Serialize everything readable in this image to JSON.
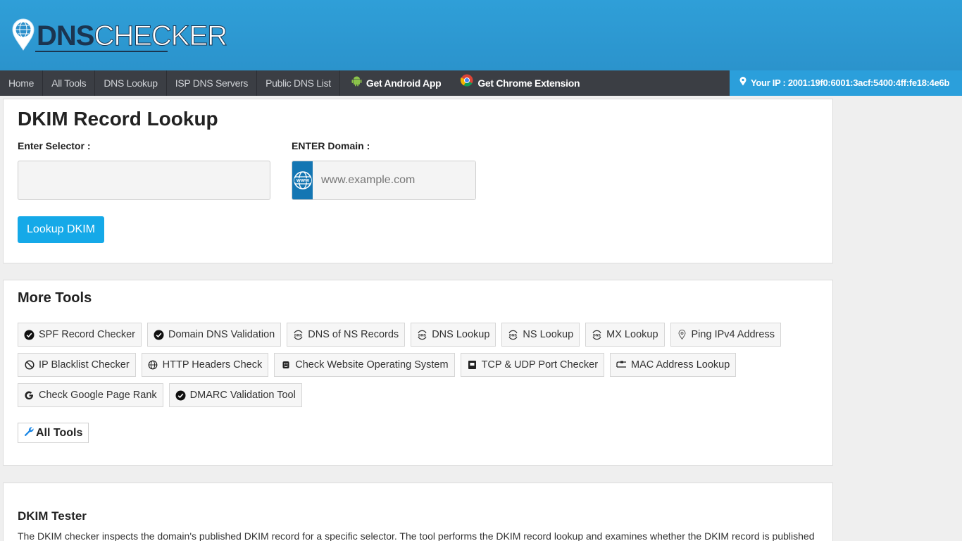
{
  "brand": {
    "logo_text_dns": "DNS",
    "logo_text_checker": "CHECKER",
    "header_color": "#2f9fd8"
  },
  "nav": {
    "items": [
      {
        "label": "Home"
      },
      {
        "label": "All Tools"
      },
      {
        "label": "DNS Lookup"
      },
      {
        "label": "ISP DNS Servers"
      },
      {
        "label": "Public DNS List"
      }
    ],
    "android_label": "Get Android App",
    "chrome_label": "Get Chrome Extension",
    "ip_text": "Your IP : 2001:19f0:6001:3acf:5400:4ff:fe18:4e6b"
  },
  "lookup": {
    "title": "DKIM Record Lookup",
    "selector_label": "Enter Selector :",
    "selector_value": "",
    "domain_label": "ENTER Domain :",
    "domain_placeholder": "www.example.com",
    "button_label": "Lookup DKIM",
    "accent": "#15a9e8"
  },
  "more_tools": {
    "title": "More Tools",
    "items": [
      {
        "label": "SPF Record Checker",
        "icon": "check-circle-icon"
      },
      {
        "label": "Domain DNS Validation",
        "icon": "check-circle-icon"
      },
      {
        "label": "DNS of NS Records",
        "icon": "dns-icon"
      },
      {
        "label": "DNS Lookup",
        "icon": "dns-icon"
      },
      {
        "label": "NS Lookup",
        "icon": "dns-icon"
      },
      {
        "label": "MX Lookup",
        "icon": "dns-icon"
      },
      {
        "label": "Ping IPv4 Address",
        "icon": "location-pin-icon"
      },
      {
        "label": "IP Blacklist Checker",
        "icon": "ban-icon"
      },
      {
        "label": "HTTP Headers Check",
        "icon": "globe-icon"
      },
      {
        "label": "Check Website Operating System",
        "icon": "os-icon"
      },
      {
        "label": "TCP & UDP Port Checker",
        "icon": "port-icon"
      },
      {
        "label": "MAC Address Lookup",
        "icon": "network-cable-icon"
      },
      {
        "label": "Check Google Page Rank",
        "icon": "google-icon"
      },
      {
        "label": "DMARC Validation Tool",
        "icon": "check-circle-icon"
      }
    ],
    "all_tools_label": "All Tools"
  },
  "article": {
    "heading": "DKIM Tester",
    "text": "The DKIM checker inspects the domain's published DKIM record for a specific selector. The tool performs the DKIM record lookup and examines whether the DKIM record is published"
  }
}
